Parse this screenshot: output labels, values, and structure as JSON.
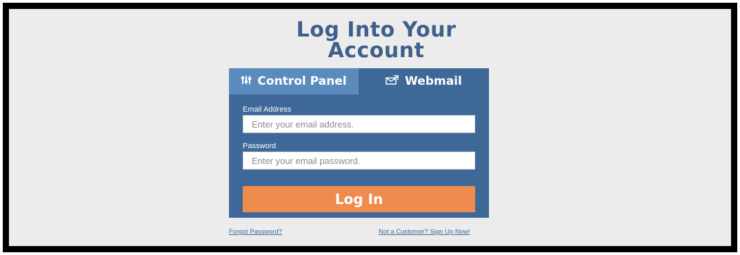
{
  "heading": {
    "line1": "Log Into Your",
    "line2": "Account"
  },
  "tabs": [
    {
      "label": "Control Panel",
      "icon": "sliders-icon",
      "active": false
    },
    {
      "label": "Webmail",
      "icon": "envelope-icon",
      "active": true
    }
  ],
  "form": {
    "email_label": "Email Address",
    "email_placeholder": "Enter your email address.",
    "password_label": "Password",
    "password_placeholder": "Enter your email password.",
    "login_label": "Log In"
  },
  "links": {
    "forgot": "Forgot Password?",
    "signup": "Not a Customer? Sign Up Now!"
  },
  "colors": {
    "panel": "#3e6898",
    "inactive_tab": "#5b8bbd",
    "button": "#ef8b4d",
    "title": "#3f5f8c",
    "background": "#ececec"
  }
}
